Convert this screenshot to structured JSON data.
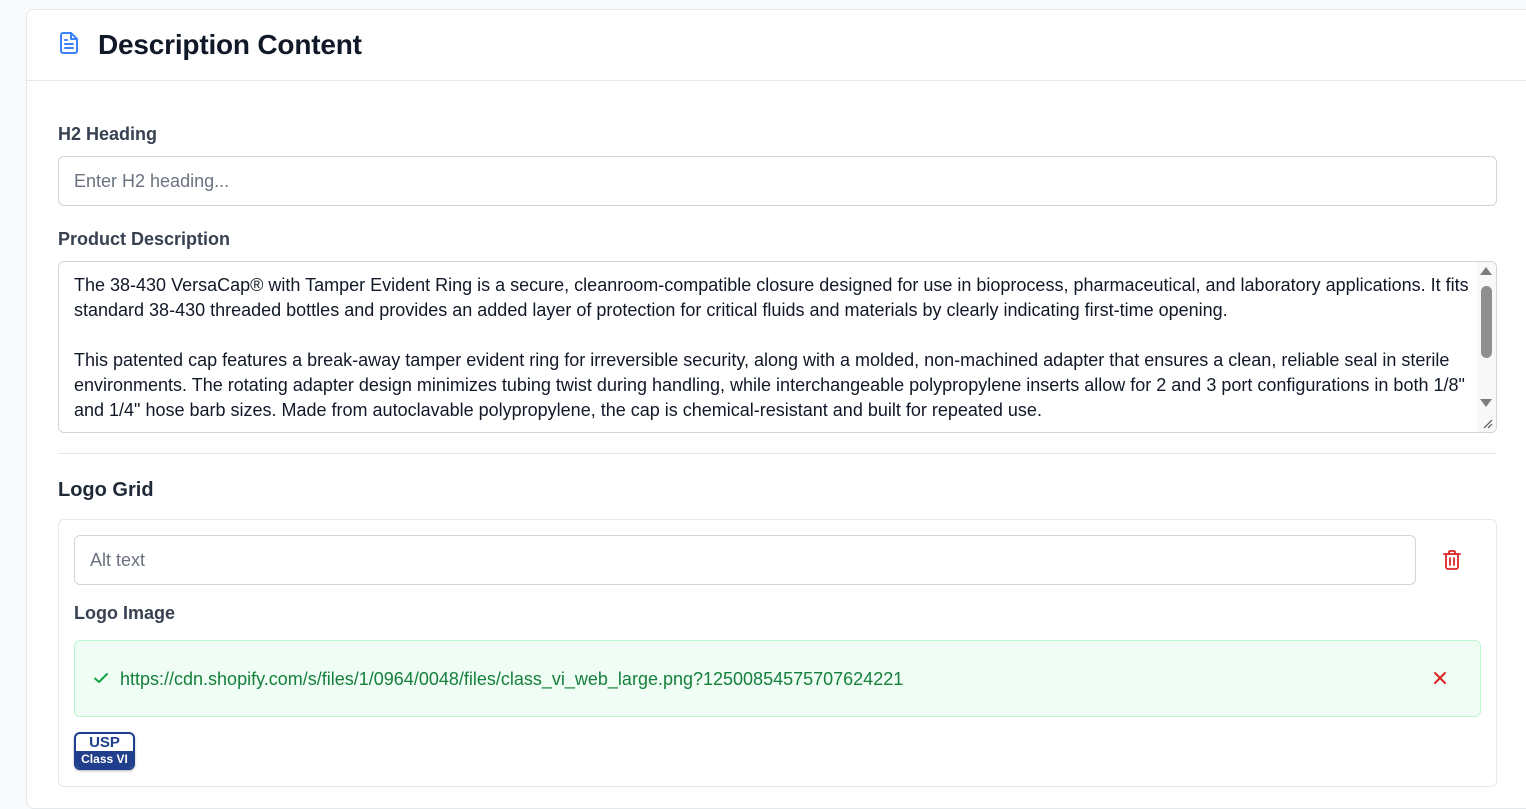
{
  "header": {
    "title": "Description Content",
    "icon": "document-icon",
    "icon_color": "#3b82f6"
  },
  "h2_heading": {
    "label": "H2 Heading",
    "placeholder": "Enter H2 heading...",
    "value": ""
  },
  "product_description": {
    "label": "Product Description",
    "value": "The 38-430 VersaCap® with Tamper Evident Ring is a secure, cleanroom-compatible closure designed for use in bioprocess, pharmaceutical, and laboratory applications. It fits standard 38-430 threaded bottles and provides an added layer of protection for critical fluids and materials by clearly indicating first-time opening.\n\nThis patented cap features a break-away tamper evident ring for irreversible security, along with a molded, non-machined adapter that ensures a clean, reliable seal in sterile environments. The rotating adapter design minimizes tubing twist during handling, while interchangeable polypropylene inserts allow for 2 and 3 port configurations in both 1/8\" and 1/4\" hose barb sizes. Made from autoclavable polypropylene, the cap is chemical-resistant and built for repeated use."
  },
  "logo_grid": {
    "title": "Logo Grid",
    "items": [
      {
        "alt_placeholder": "Alt text",
        "alt_value": "",
        "delete_icon": "trash-icon",
        "image_label": "Logo Image",
        "image_url": "https://cdn.shopify.com/s/files/1/0964/0048/files/class_vi_web_large.png?12500854575707624221",
        "status_icon": "check-icon",
        "remove_icon": "close-icon",
        "preview": {
          "line1": "USP",
          "line2": "Class VI"
        }
      }
    ]
  },
  "colors": {
    "accent": "#3b82f6",
    "danger": "#dc2626",
    "success_text": "#15803d",
    "success_bg": "#f0fdf4",
    "logo_blue": "#1f3f8c"
  }
}
